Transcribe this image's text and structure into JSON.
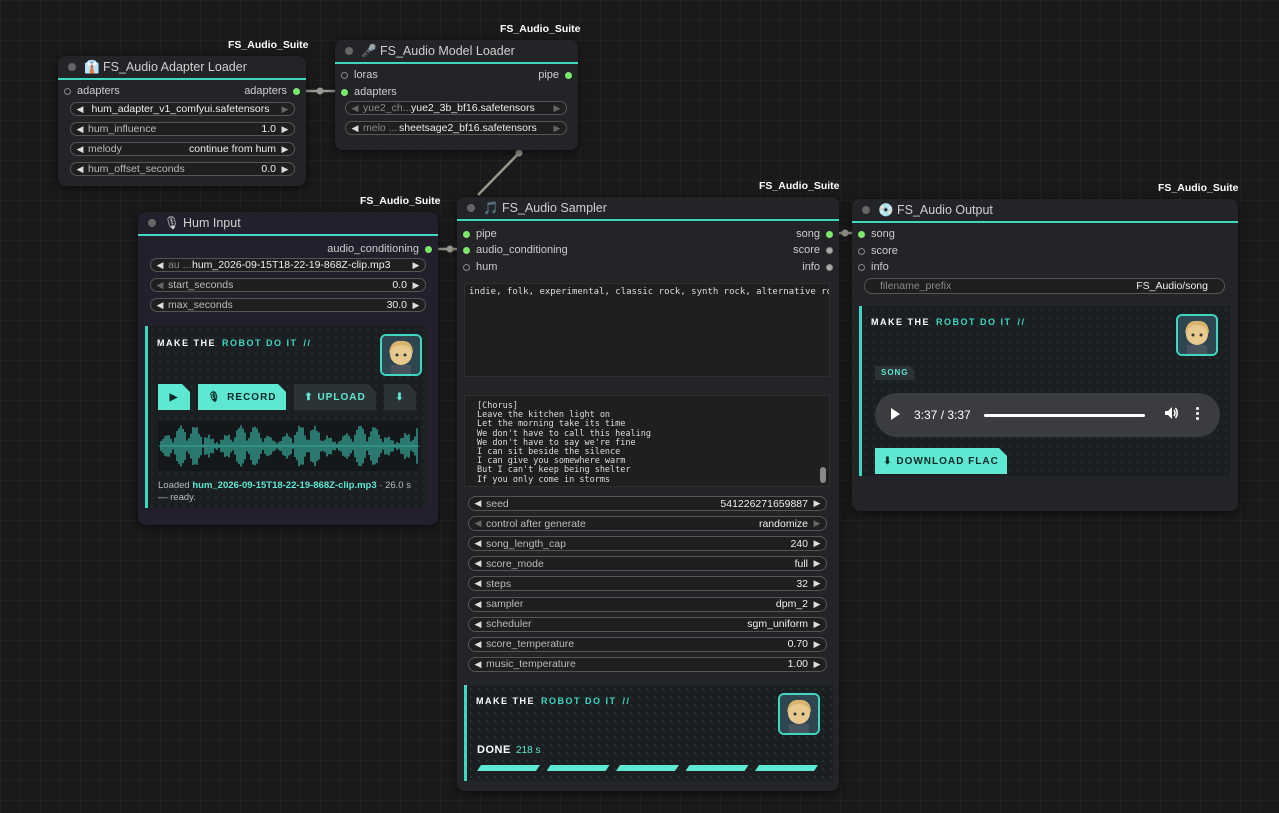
{
  "suite": "FS_Audio_Suite",
  "adapter_loader": {
    "title": "FS_Audio Adapter Loader",
    "icon": "tie-icon",
    "input": "adapters",
    "output": "adapters",
    "widgets": [
      {
        "label": "",
        "value": "hum_adapter_v1_comfyui.safetensors"
      },
      {
        "label": "hum_influence",
        "value": "1.0"
      },
      {
        "label": "melody",
        "value": "continue from hum"
      },
      {
        "label": "hum_offset_seconds",
        "value": "0.0"
      }
    ]
  },
  "model_loader": {
    "title": "FS_Audio Model Loader",
    "icon": "microphone-icon",
    "inputs": [
      "loras",
      "adapters"
    ],
    "output": "pipe",
    "widgets": [
      {
        "label": "yue2_ch...",
        "value": "yue2_3b_bf16.safetensors"
      },
      {
        "label": "melo ...",
        "value": "sheetsage2_bf16.safetensors"
      }
    ]
  },
  "hum_input": {
    "title": "Hum Input",
    "icon": "microphone-icon",
    "output": "audio_conditioning",
    "widgets": [
      {
        "label": "au ...",
        "value": "hum_2026-09-15T18-22-19-868Z-clip.mp3"
      },
      {
        "label": "start_seconds",
        "value": "0.0"
      },
      {
        "label": "max_seconds",
        "value": "30.0"
      }
    ],
    "brand": {
      "prefix": "MAKE THE",
      "accent": "ROBOT DO IT",
      "slash": "//"
    },
    "buttons": {
      "play": "▶",
      "record": "RECORD",
      "upload": "⬆ UPLOAD",
      "download": "⬇"
    },
    "status_prefix": "Loaded ",
    "status_file": "hum_2026-09-15T18-22-19-868Z-clip.mp3",
    "status_suffix": " · 26.0 s — ready."
  },
  "sampler": {
    "title": "FS_Audio Sampler",
    "icon": "music-note-icon",
    "inputs": [
      "pipe",
      "audio_conditioning",
      "hum"
    ],
    "outputs": [
      "song",
      "score",
      "info"
    ],
    "tags": "indie, folk, experimental, classic rock, synth rock, alternative rock",
    "lyrics": "[Chorus]\nLeave the kitchen light on\nLet the morning take its time\nWe don't have to call this healing\nWe don't have to say we're fine\nI can sit beside the silence\nI can give you somewhere warm\nBut I can't keep being shelter\nIf you only come in storms",
    "widgets": [
      {
        "label": "seed",
        "value": "541226271659887",
        "dim": false
      },
      {
        "label": "control after generate",
        "value": "randomize",
        "dim": true
      },
      {
        "label": "song_length_cap",
        "value": "240",
        "dim": false
      },
      {
        "label": "score_mode",
        "value": "full",
        "dim": false
      },
      {
        "label": "steps",
        "value": "32",
        "dim": false
      },
      {
        "label": "sampler",
        "value": "dpm_2",
        "dim": false
      },
      {
        "label": "scheduler",
        "value": "sgm_uniform",
        "dim": false
      },
      {
        "label": "score_temperature",
        "value": "0.70",
        "dim": false
      },
      {
        "label": "music_temperature",
        "value": "1.00",
        "dim": false
      }
    ],
    "brand": {
      "prefix": "MAKE THE",
      "accent": "ROBOT DO IT",
      "slash": "//"
    },
    "done_label": "DONE",
    "done_time": "218 s",
    "progress": 1.0
  },
  "output": {
    "title": "FS_Audio Output",
    "icon": "disc-icon",
    "inputs": [
      "song",
      "score",
      "info"
    ],
    "widget": {
      "label": "filename_prefix",
      "value": "FS_Audio/song"
    },
    "brand": {
      "prefix": "MAKE THE",
      "accent": "ROBOT DO IT",
      "slash": "//"
    },
    "tag": "SONG",
    "player_time": "3:37 / 3:37",
    "player_progress": 1.0,
    "download": "⬇ DOWNLOAD FLAC"
  }
}
